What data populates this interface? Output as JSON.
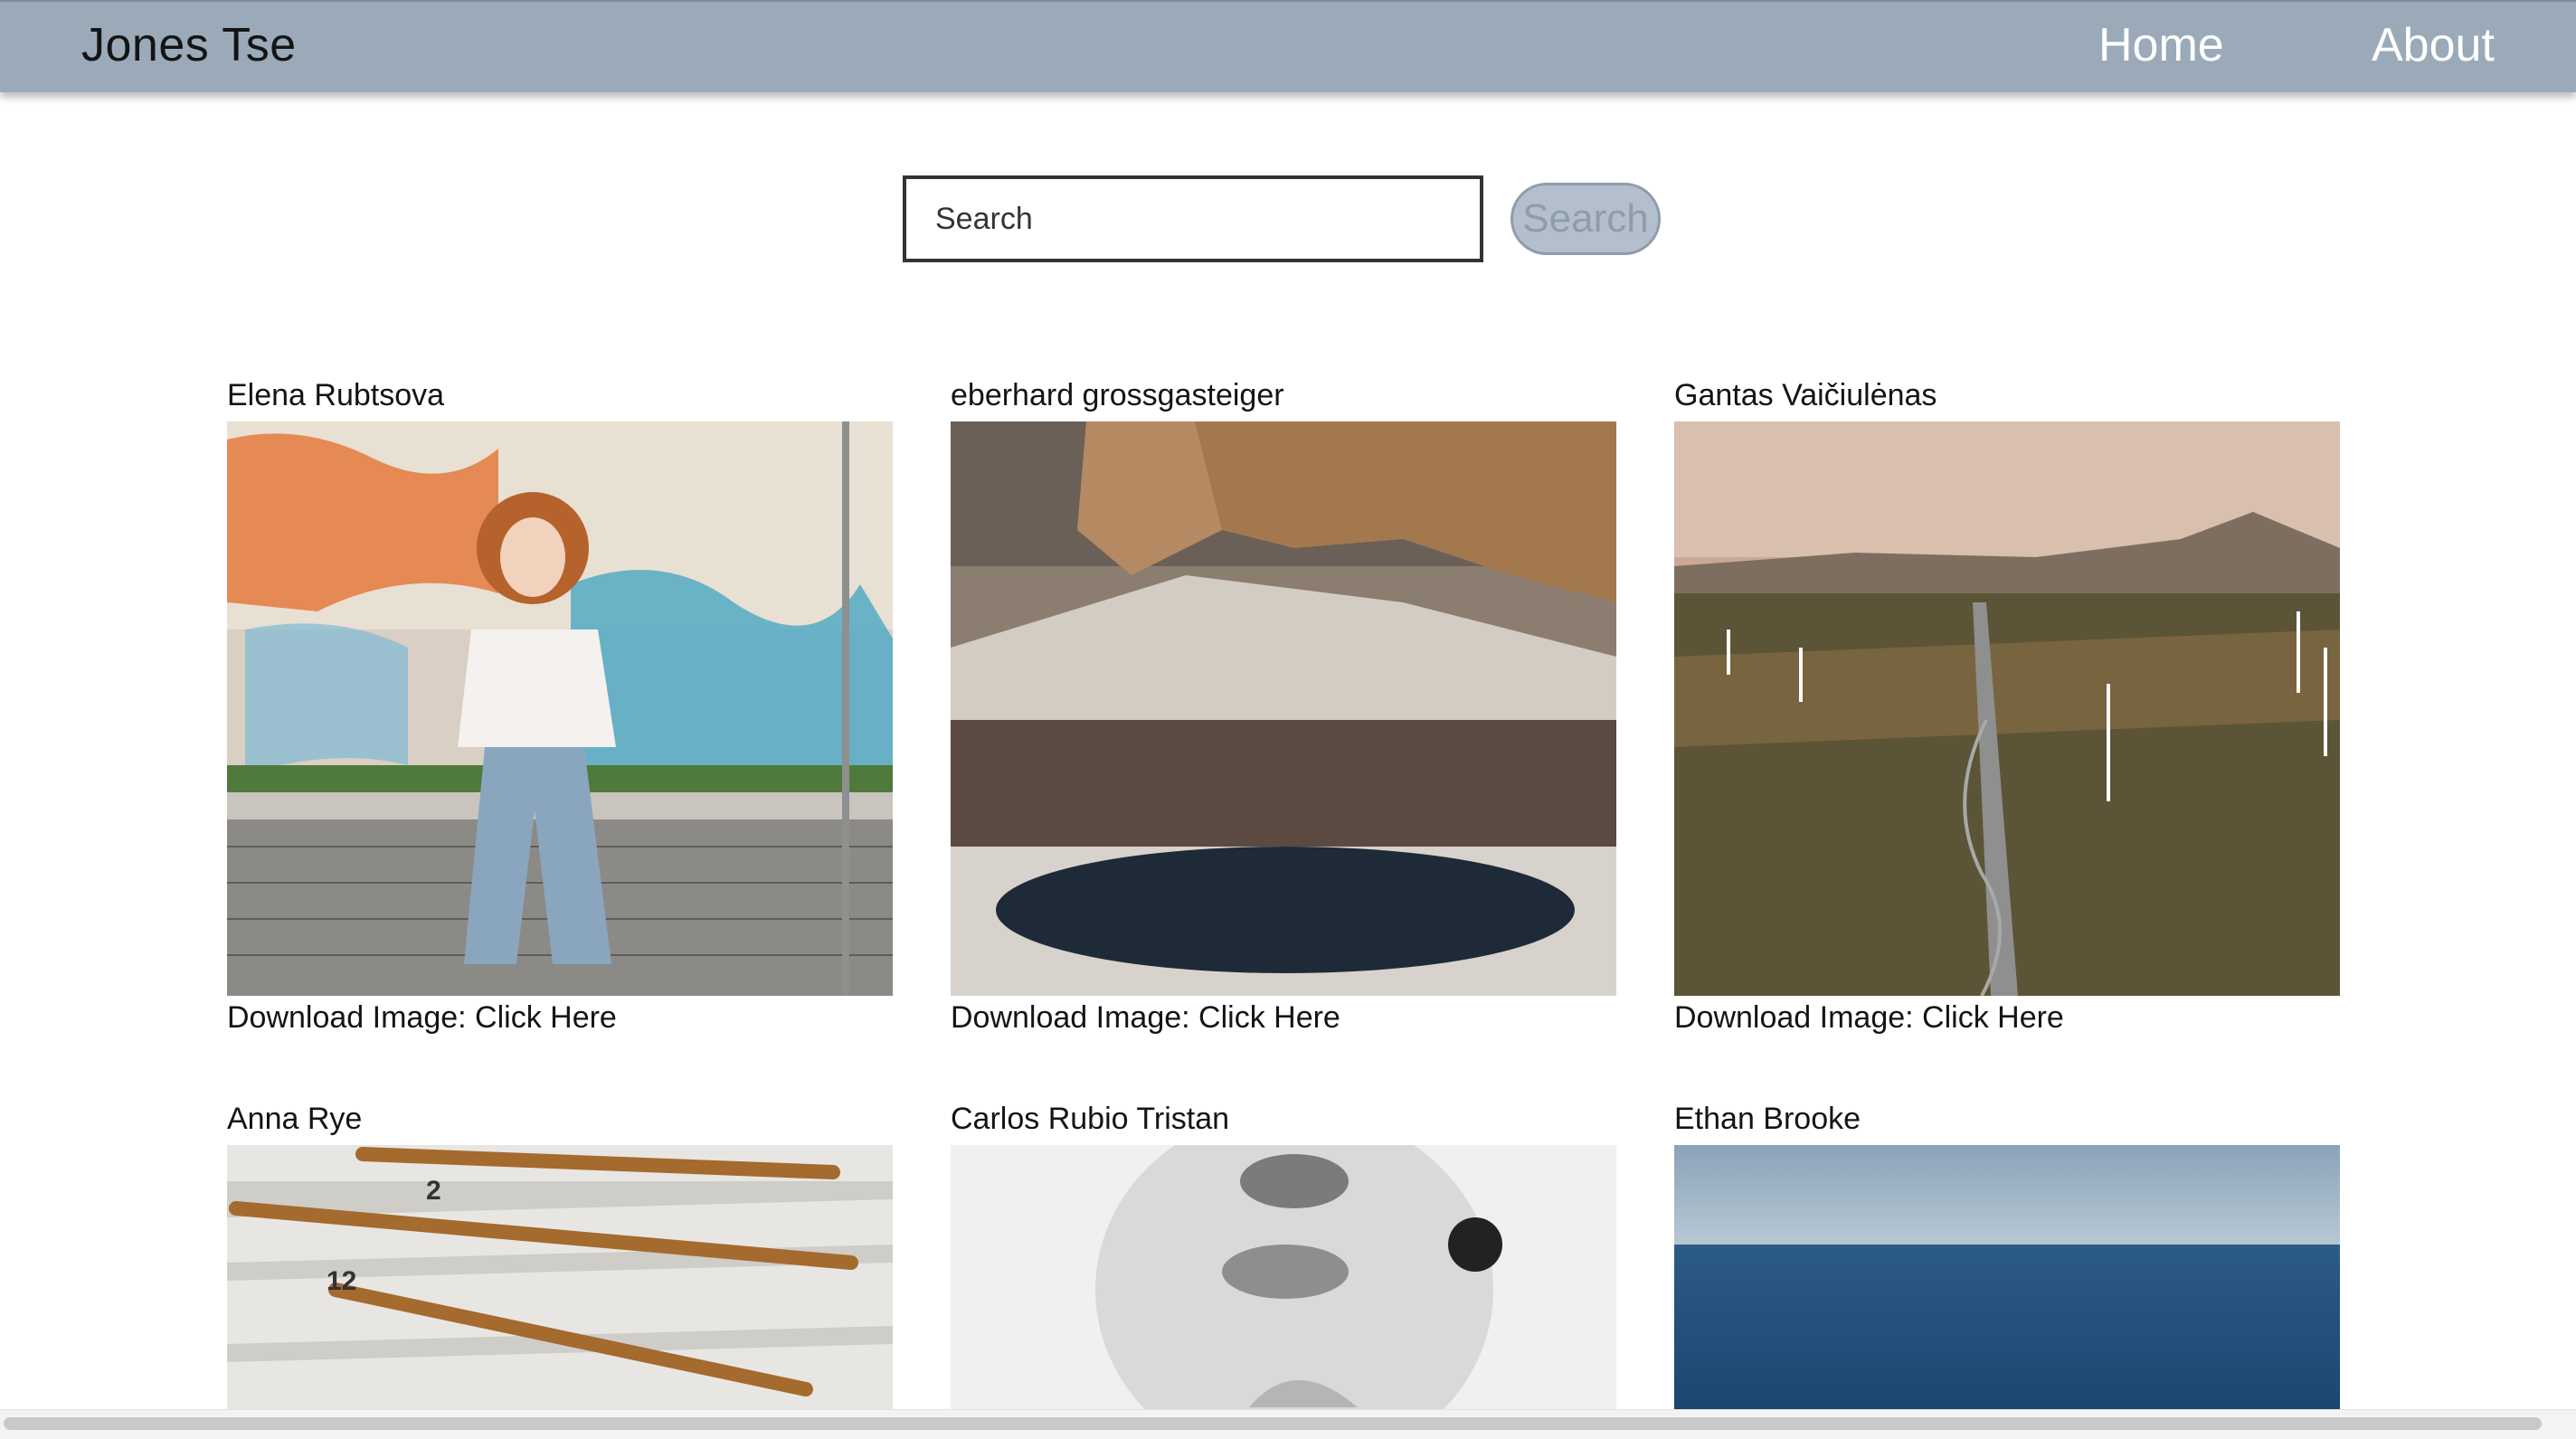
{
  "header": {
    "brand": "Jones Tse",
    "nav": [
      {
        "label": "Home"
      },
      {
        "label": "About"
      }
    ]
  },
  "search": {
    "placeholder": "Search",
    "value": "",
    "button_label": "Search"
  },
  "gallery": {
    "download_text": "Download Image: Click Here",
    "items": [
      {
        "name": "Elena Rubtsova"
      },
      {
        "name": "eberhard grossgasteiger"
      },
      {
        "name": "Gantas Vaičiulėnas"
      },
      {
        "name": "Anna Rye"
      },
      {
        "name": "Carlos Rubio Tristan"
      },
      {
        "name": "Ethan Brooke"
      }
    ]
  },
  "colors": {
    "navbar": "#9aaab9",
    "search_button": "#b3bfcc",
    "text": "#141414"
  }
}
